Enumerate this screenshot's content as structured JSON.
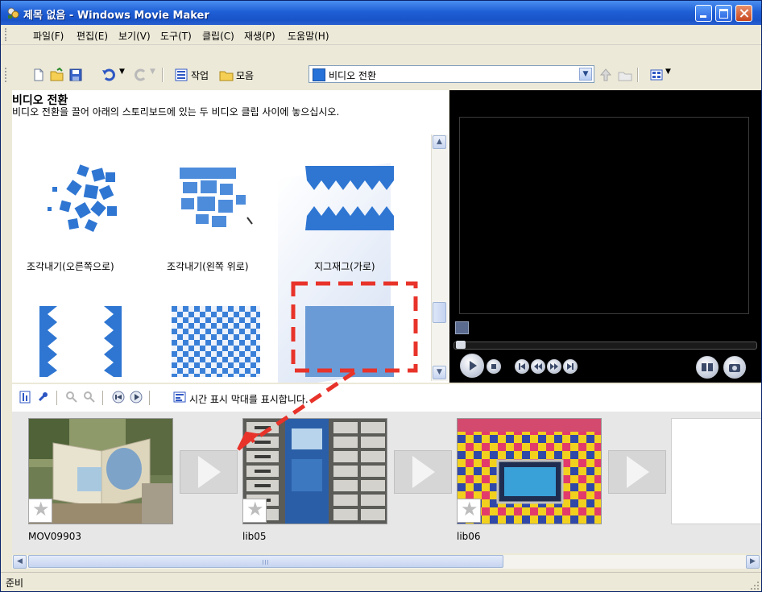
{
  "window": {
    "title": "제목 없음 - Windows Movie Maker"
  },
  "menu": {
    "items": [
      "파일(F)",
      "편집(E)",
      "보기(V)",
      "도구(T)",
      "클립(C)",
      "재생(P)",
      "도움말(H)"
    ]
  },
  "toolbar": {
    "tasks_label": "작업",
    "collections_label": "모음",
    "view_select_value": "비디오 전환"
  },
  "task_pane": {
    "title": "비디오 전환",
    "description": "비디오 전환을 끌어 아래의 스토리보드에 있는 두 비디오 클립 사이에 놓으십시오.",
    "transitions": [
      {
        "label": "조각내기(오른쪽으로)",
        "icon": "shatter-right-thumbnail"
      },
      {
        "label": "조각내기(왼쪽 위로)",
        "icon": "shatter-upper-left-thumbnail"
      },
      {
        "label": "지그재그(가로)",
        "icon": "zigzag-horizontal-thumbnail"
      },
      {
        "label": "",
        "icon": "zigzag-vertical-thumbnail"
      },
      {
        "label": "",
        "icon": "checkerboard-thumbnail"
      },
      {
        "label": "",
        "icon": "plain-fade-thumbnail"
      }
    ]
  },
  "timeline_toolbar": {
    "show_timeline_label": "시간 표시 막대를 표시합니다."
  },
  "storyboard": {
    "clips": [
      {
        "name": "MOV09903",
        "icon": "book-sculpture-thumbnail"
      },
      {
        "name": "lib05",
        "icon": "lockers-thumbnail"
      },
      {
        "name": "lib06",
        "icon": "checkered-wall-screen-thumbnail"
      }
    ]
  },
  "status": {
    "text": "준비"
  },
  "colors": {
    "title_bar": "#1f5fd6",
    "highlight_dashes": "#e8332a",
    "transition_blue": "#2f76d2"
  }
}
